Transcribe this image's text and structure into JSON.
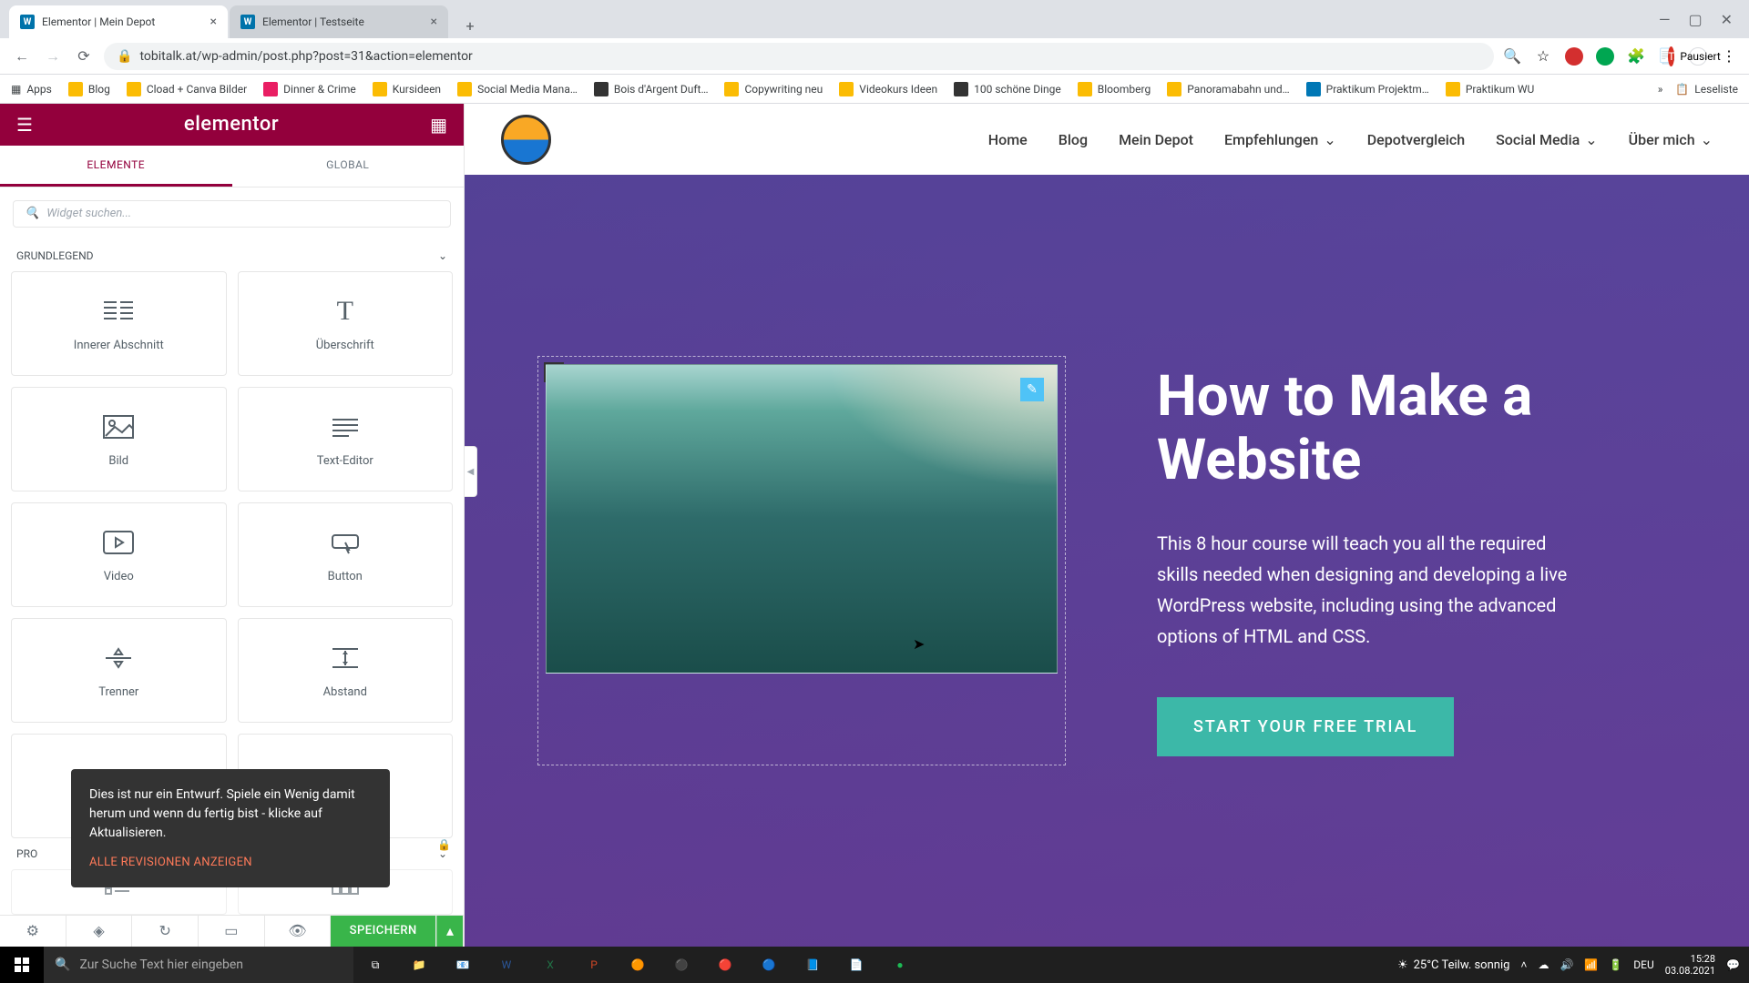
{
  "browser": {
    "tabs": [
      {
        "title": "Elementor | Mein Depot",
        "active": true
      },
      {
        "title": "Elementor | Testseite",
        "active": false
      }
    ],
    "url": "tobitalk.at/wp-admin/post.php?post=31&action=elementor",
    "profile_label": "Pausiert",
    "profile_initial": "T",
    "bookmarks": [
      "Apps",
      "Blog",
      "Cload + Canva Bilder",
      "Dinner & Crime",
      "Kursideen",
      "Social Media Mana…",
      "Bois d'Argent Duft…",
      "Copywriting neu",
      "Videokurs Ideen",
      "100 schöne Dinge",
      "Bloomberg",
      "Panoramabahn und…",
      "Praktikum Projektm…",
      "Praktikum WU"
    ],
    "reading_list": "Leseliste"
  },
  "elementor": {
    "brand": "elementor",
    "tabs": {
      "elemente": "ELEMENTE",
      "global": "GLOBAL"
    },
    "search_placeholder": "Widget suchen...",
    "sections": {
      "grundlegend": "GRUNDLEGEND",
      "pro": "PRO"
    },
    "widgets": [
      {
        "label": "Innerer Abschnitt",
        "icon": "columns"
      },
      {
        "label": "Überschrift",
        "icon": "heading"
      },
      {
        "label": "Bild",
        "icon": "image"
      },
      {
        "label": "Text-Editor",
        "icon": "text"
      },
      {
        "label": "Video",
        "icon": "video"
      },
      {
        "label": "Button",
        "icon": "button"
      },
      {
        "label": "Trenner",
        "icon": "divider"
      },
      {
        "label": "Abstand",
        "icon": "spacer"
      }
    ],
    "save": "SPEICHERN",
    "tooltip": {
      "text": "Dies ist nur ein Entwurf. Spiele ein Wenig damit herum und wenn du fertig bist - klicke auf Aktualisieren.",
      "link": "ALLE REVISIONEN ANZEIGEN"
    }
  },
  "site": {
    "nav": [
      "Home",
      "Blog",
      "Mein Depot",
      "Empfehlungen",
      "Depotvergleich",
      "Social Media",
      "Über mich"
    ],
    "hero": {
      "title": "How to Make a Website",
      "body": "This 8 hour course will teach you all the required skills needed when designing and developing a live WordPress website, including using the advanced options of HTML and CSS.",
      "cta": "START YOUR FREE TRIAL"
    }
  },
  "taskbar": {
    "search_placeholder": "Zur Suche Text hier eingeben",
    "weather": "25°C  Teilw. sonnig",
    "lang": "DEU",
    "time": "15:28",
    "date": "03.08.2021"
  }
}
